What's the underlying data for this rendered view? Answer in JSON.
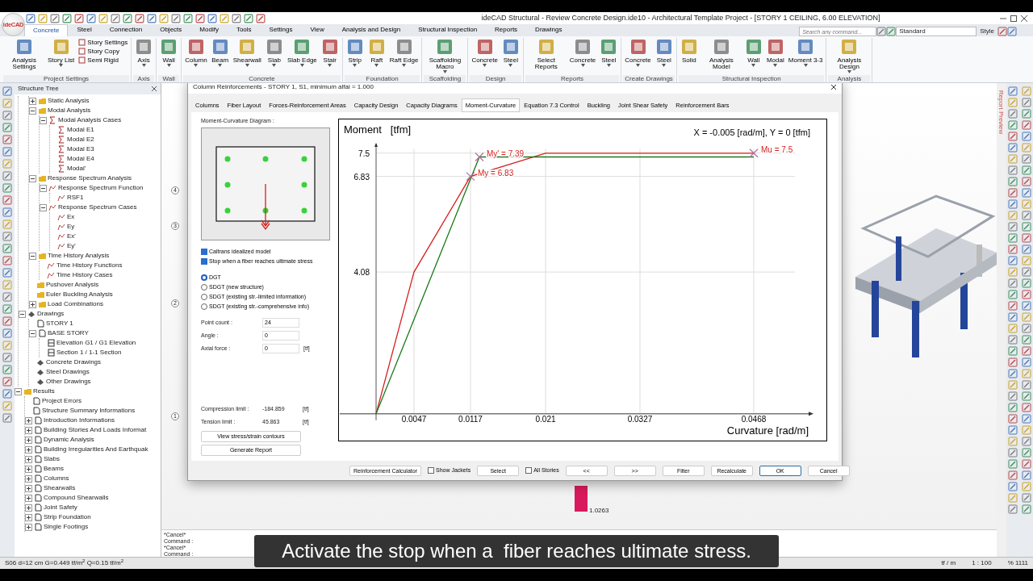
{
  "app": {
    "logo": "ideCAD",
    "title": "ideCAD Structural - Review Concrete Design.ide10 - Architectural Template Project - [STORY 1 CEILING,  6.00 ELEVATION]"
  },
  "ribbon_tabs": [
    {
      "label": "Concrete",
      "selected": true
    },
    {
      "label": "Steel",
      "selected": false
    },
    {
      "label": "Connection",
      "selected": false
    },
    {
      "label": "Objects",
      "selected": false
    },
    {
      "label": "Modify",
      "selected": false
    },
    {
      "label": "Tools",
      "selected": false
    },
    {
      "label": "Settings",
      "selected": false
    },
    {
      "label": "View",
      "selected": false
    },
    {
      "label": "Analysis and Design",
      "selected": false
    },
    {
      "label": "Structural Inspection",
      "selected": false
    },
    {
      "label": "Reports",
      "selected": false
    },
    {
      "label": "Drawings",
      "selected": false
    }
  ],
  "search": {
    "placeholder": "Search any command..."
  },
  "style_combo": {
    "value": "Standard"
  },
  "style_label": "Style",
  "ribbon_groups": [
    {
      "title": "Project Settings",
      "buttons": [
        {
          "label": "Analysis Settings",
          "dropdown": false
        },
        {
          "label": "Story List",
          "dropdown": true
        }
      ],
      "small": [
        {
          "label": "Story Settings"
        },
        {
          "label": "Story Copy"
        },
        {
          "label": "Semi Rigid"
        }
      ]
    },
    {
      "title": "Axis",
      "buttons": [
        {
          "label": "Axis",
          "dropdown": true
        }
      ]
    },
    {
      "title": "Wall",
      "buttons": [
        {
          "label": "Wall",
          "dropdown": true
        }
      ]
    },
    {
      "title": "Concrete",
      "buttons": [
        {
          "label": "Column",
          "dropdown": true
        },
        {
          "label": "Beam",
          "dropdown": true
        },
        {
          "label": "Shearwall",
          "dropdown": true
        },
        {
          "label": "Slab",
          "dropdown": true
        },
        {
          "label": "Slab Edge",
          "dropdown": true
        },
        {
          "label": "Stair",
          "dropdown": true
        }
      ]
    },
    {
      "title": "Foundation",
      "buttons": [
        {
          "label": "Strip",
          "dropdown": true
        },
        {
          "label": "Raft",
          "dropdown": true
        },
        {
          "label": "Raft Edge",
          "dropdown": true
        }
      ]
    },
    {
      "title": "Scaffolding",
      "buttons": [
        {
          "label": "Scaffolding Macro",
          "dropdown": true
        }
      ]
    },
    {
      "title": "Design",
      "buttons": [
        {
          "label": "Concrete",
          "dropdown": true
        },
        {
          "label": "Steel",
          "dropdown": true
        }
      ]
    },
    {
      "title": "Reports",
      "buttons": [
        {
          "label": "Select Reports",
          "dropdown": false
        },
        {
          "label": "Concrete",
          "dropdown": true
        },
        {
          "label": "Steel",
          "dropdown": true
        }
      ]
    },
    {
      "title": "Create Drawings",
      "buttons": [
        {
          "label": "Concrete",
          "dropdown": true
        },
        {
          "label": "Steel",
          "dropdown": true
        }
      ]
    },
    {
      "title": "Structural Inspection",
      "buttons": [
        {
          "label": "Solid",
          "dropdown": false
        },
        {
          "label": "Analysis Model",
          "dropdown": false
        },
        {
          "label": "Wall",
          "dropdown": true
        },
        {
          "label": "Modal",
          "dropdown": true
        },
        {
          "label": "Moment 3-3",
          "dropdown": true
        }
      ]
    },
    {
      "title": "Analysis",
      "buttons": [
        {
          "label": "Analysis Design",
          "dropdown": true
        }
      ]
    }
  ],
  "tree": {
    "title": "Structure Tree",
    "items": [
      {
        "children": [
          {
            "children": [
              {
                "label": "Static Analysis",
                "kind": "folder",
                "expanded": false
              },
              {
                "label": "Modal Analysis",
                "kind": "folder",
                "expanded": true,
                "children": [
                  {
                    "label": "Modal Analysis Cases",
                    "kind": "sigma",
                    "expanded": true,
                    "children": [
                      {
                        "label": "Modal E1",
                        "kind": "sigma"
                      },
                      {
                        "label": "Modal E2",
                        "kind": "sigma"
                      },
                      {
                        "label": "Modal E3",
                        "kind": "sigma"
                      },
                      {
                        "label": "Modal E4",
                        "kind": "sigma"
                      },
                      {
                        "label": "Modal'",
                        "kind": "sigma"
                      }
                    ]
                  }
                ]
              },
              {
                "label": "Response Spectrum Analysis",
                "kind": "folder",
                "expanded": true,
                "children": [
                  {
                    "label": "Response Spectrum Function",
                    "kind": "spectrum",
                    "expanded": true,
                    "children": [
                      {
                        "label": "RSF1",
                        "kind": "spectrum"
                      }
                    ]
                  },
                  {
                    "label": "Response Spectrum Cases",
                    "kind": "spectrum",
                    "expanded": true,
                    "children": [
                      {
                        "label": "Ex",
                        "kind": "spectrum"
                      },
                      {
                        "label": "Ey",
                        "kind": "spectrum"
                      },
                      {
                        "label": "Ex'",
                        "kind": "spectrum"
                      },
                      {
                        "label": "Ey'",
                        "kind": "spectrum"
                      }
                    ]
                  }
                ]
              },
              {
                "label": "Time History Analysis",
                "kind": "folder",
                "expanded": true,
                "children": [
                  {
                    "label": "Time History Functions",
                    "kind": "spectrum"
                  },
                  {
                    "label": "Time History Cases",
                    "kind": "spectrum"
                  }
                ]
              },
              {
                "label": "Pushover Analysis",
                "kind": "folder"
              },
              {
                "label": "Euler Buckling Analysis",
                "kind": "folder"
              },
              {
                "label": "Load Combinations",
                "kind": "folder",
                "expanded": false
              }
            ]
          },
          {
            "label": "Drawings",
            "kind": "drawings",
            "expanded": true,
            "children": [
              {
                "label": "STORY 1",
                "kind": "page"
              },
              {
                "label": "BASE STORY",
                "kind": "page",
                "expanded": true,
                "children": [
                  {
                    "label": "Elevation G1 / G1 Elevation",
                    "kind": "section"
                  },
                  {
                    "label": "Section 1 / 1-1 Section",
                    "kind": "section"
                  }
                ]
              },
              {
                "label": "Concrete Drawings",
                "kind": "drawings"
              },
              {
                "label": "Steel Drawings",
                "kind": "drawings"
              },
              {
                "label": "Other Drawings",
                "kind": "drawings"
              }
            ]
          }
        ]
      },
      {
        "label": "Results",
        "kind": "folder",
        "expanded": true,
        "children": [
          {
            "label": "Project Errors",
            "kind": "page"
          },
          {
            "label": "Structure Summary Informations",
            "kind": "page"
          },
          {
            "label": "Introduction Informations",
            "kind": "page",
            "expanded": false
          },
          {
            "label": "Building Stories And Loads Informat",
            "kind": "page",
            "expanded": false
          },
          {
            "label": "Dynamic Analysis",
            "kind": "page",
            "expanded": false
          },
          {
            "label": "Building Irregularities And Earthquak",
            "kind": "page",
            "expanded": false
          },
          {
            "label": "Slabs",
            "kind": "page",
            "expanded": false
          },
          {
            "label": "Beams",
            "kind": "page",
            "expanded": false
          },
          {
            "label": "Columns",
            "kind": "page",
            "expanded": false
          },
          {
            "label": "Shearwalls",
            "kind": "page",
            "expanded": false
          },
          {
            "label": "Compound Shearwalls",
            "kind": "page",
            "expanded": false
          },
          {
            "label": "Joint Safety",
            "kind": "page",
            "expanded": false
          },
          {
            "label": "Strip Foundation",
            "kind": "page",
            "expanded": false
          },
          {
            "label": "Single Footings",
            "kind": "page",
            "expanded": false
          }
        ]
      }
    ]
  },
  "view": {
    "axis_labels": [
      "4",
      "3",
      "2",
      "1"
    ],
    "bar_value": "1.0263",
    "side_tab": "Report Preview"
  },
  "dialog": {
    "title": "Column Reinforcements - STORY 1, S1, minimum alfai = 1.000",
    "tabs": [
      {
        "label": "Columns",
        "selected": false
      },
      {
        "label": "Fiber Layout",
        "selected": false
      },
      {
        "label": "Forces-Reinforcement Areas",
        "selected": false
      },
      {
        "label": "Capacity Design",
        "selected": false
      },
      {
        "label": "Capacity Diagrams",
        "selected": false
      },
      {
        "label": "Moment-Curvature",
        "selected": true
      },
      {
        "label": "Equation 7.3 Control",
        "selected": false
      },
      {
        "label": "Buckling",
        "selected": false
      },
      {
        "label": "Joint Shear Safety",
        "selected": false
      },
      {
        "label": "Reinforcement Bars",
        "selected": false
      }
    ],
    "group_title": "Moment-Curvature Diagram :",
    "options": [
      {
        "label": "Caltrans idealized model",
        "checked": true
      },
      {
        "label": "Stop when a fiber reaches ultimate stress",
        "checked": true
      }
    ],
    "radios": [
      {
        "label": "DGT",
        "selected": true
      },
      {
        "label": "SDGT (new structure)",
        "selected": false
      },
      {
        "label": "SDGT (existing str.-limited information)",
        "selected": false
      },
      {
        "label": "SDGT (existing str.-comprehensive info)",
        "selected": false
      }
    ],
    "fields": [
      {
        "label": "Point count :",
        "value": "24"
      },
      {
        "label": "Angle :",
        "value": "0"
      },
      {
        "label": "Axial force :",
        "value": "0",
        "unit": "[tf]"
      }
    ],
    "limits": [
      {
        "label": "Compression limit :",
        "value": "-184.859",
        "unit": "[tf]"
      },
      {
        "label": "Tension limit :",
        "value": "45.863",
        "unit": "[tf]"
      }
    ],
    "panel_buttons": [
      "View stress/strain contours",
      "Generate Report"
    ],
    "chart_readout": "X = -0.005 [rad/m], Y = 0 [tfm]",
    "chart_data": {
      "type": "line",
      "xlabel": "Curvature [rad/m]",
      "ylabel": "Moment   [tfm]",
      "xlim": [
        -0.0046,
        0.0558
      ],
      "ylim": [
        -0.77,
        8.47
      ],
      "grid": true,
      "xticks": [
        0.0047,
        0.0117,
        0.021,
        0.0327,
        0.0468
      ],
      "yticks": [
        4.08,
        6.83,
        7.5
      ],
      "series": [
        {
          "color": "#d62020",
          "x": [
            0,
            0.0047,
            0.0117,
            0.021,
            0.0468
          ],
          "values": [
            0,
            4.08,
            6.83,
            7.5,
            7.5
          ]
        },
        {
          "color": "#1a7a1a",
          "x": [
            0,
            0.0128,
            0.0468
          ],
          "values": [
            0,
            7.39,
            7.39
          ]
        }
      ],
      "annotations": [
        {
          "text": "My' = 7.39",
          "x": 0.0128,
          "y": 7.39
        },
        {
          "text": "My = 6.83",
          "x": 0.0117,
          "y": 6.83
        },
        {
          "text": "Mu = 7.5",
          "x": 0.0468,
          "y": 7.5
        }
      ]
    },
    "footer": [
      {
        "kind": "button",
        "label": "Reinforcement Calculator"
      },
      {
        "kind": "checkbox",
        "label": "Show Jackets",
        "checked": false
      },
      {
        "kind": "button",
        "label": "Select"
      },
      {
        "kind": "checkbox",
        "label": "All Stories",
        "checked": false
      },
      {
        "kind": "button",
        "label": "<<"
      },
      {
        "kind": "button",
        "label": ">>"
      },
      {
        "kind": "button",
        "label": "Filter"
      },
      {
        "kind": "button",
        "label": "Recalculate"
      },
      {
        "kind": "button",
        "label": "OK",
        "default": true
      },
      {
        "kind": "button",
        "label": "Cancel"
      }
    ]
  },
  "command_lines": [
    "*Cancel*",
    "Command :",
    "*Cancel*",
    "Command :"
  ],
  "status_bar": {
    "text": "S06 d=12 cm G=0.449 tf/m$^{2}$ Q=0.15 tf/m$^{2}$",
    "units": "tf / m",
    "scale": "1 : 100",
    "zoom": "% 1111"
  },
  "caption": "Activate the stop when a  fiber reaches ultimate stress."
}
